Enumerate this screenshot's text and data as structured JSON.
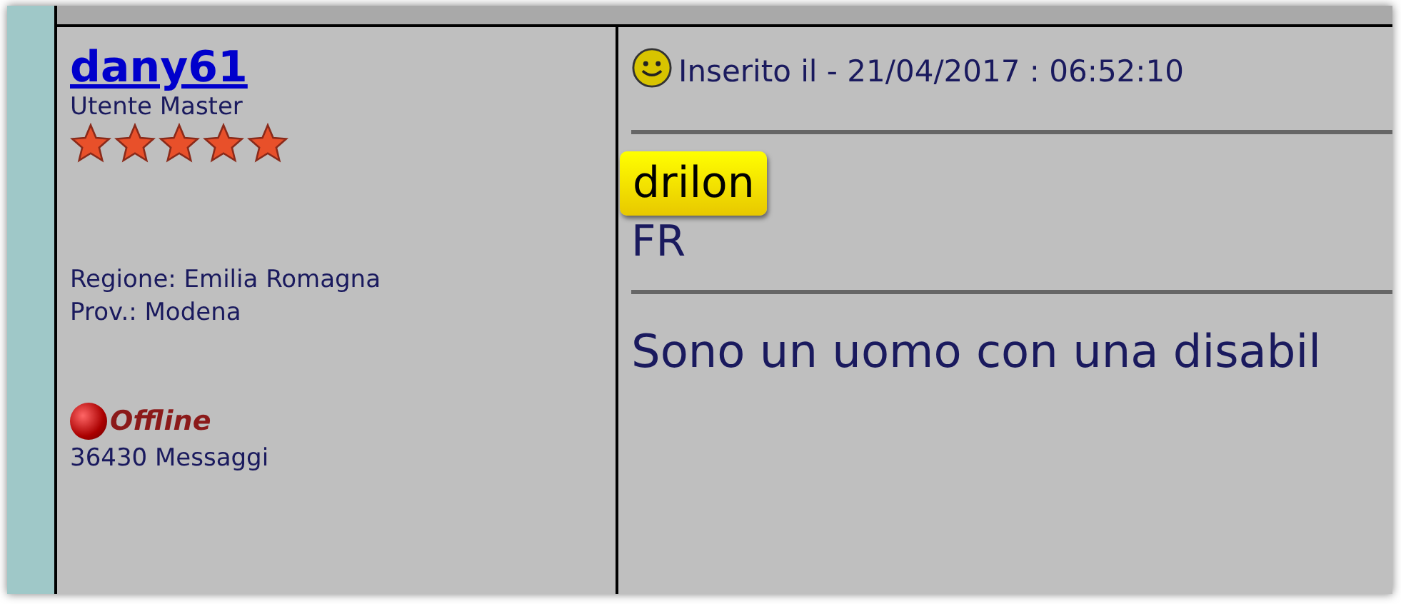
{
  "author": {
    "username": "dany61",
    "rank": "Utente Master",
    "stars": 5,
    "region": "Regione: Emilia Romagna",
    "province": "Prov.: Modena",
    "online": false,
    "status_label": "Offline",
    "post_count": "36430 Messaggi"
  },
  "post": {
    "posted": "Inserito il - 21/04/2017 : 06:52:10",
    "highlight": "drilon",
    "line_1": "FR",
    "body": "Sono un uomo con una disabil"
  }
}
